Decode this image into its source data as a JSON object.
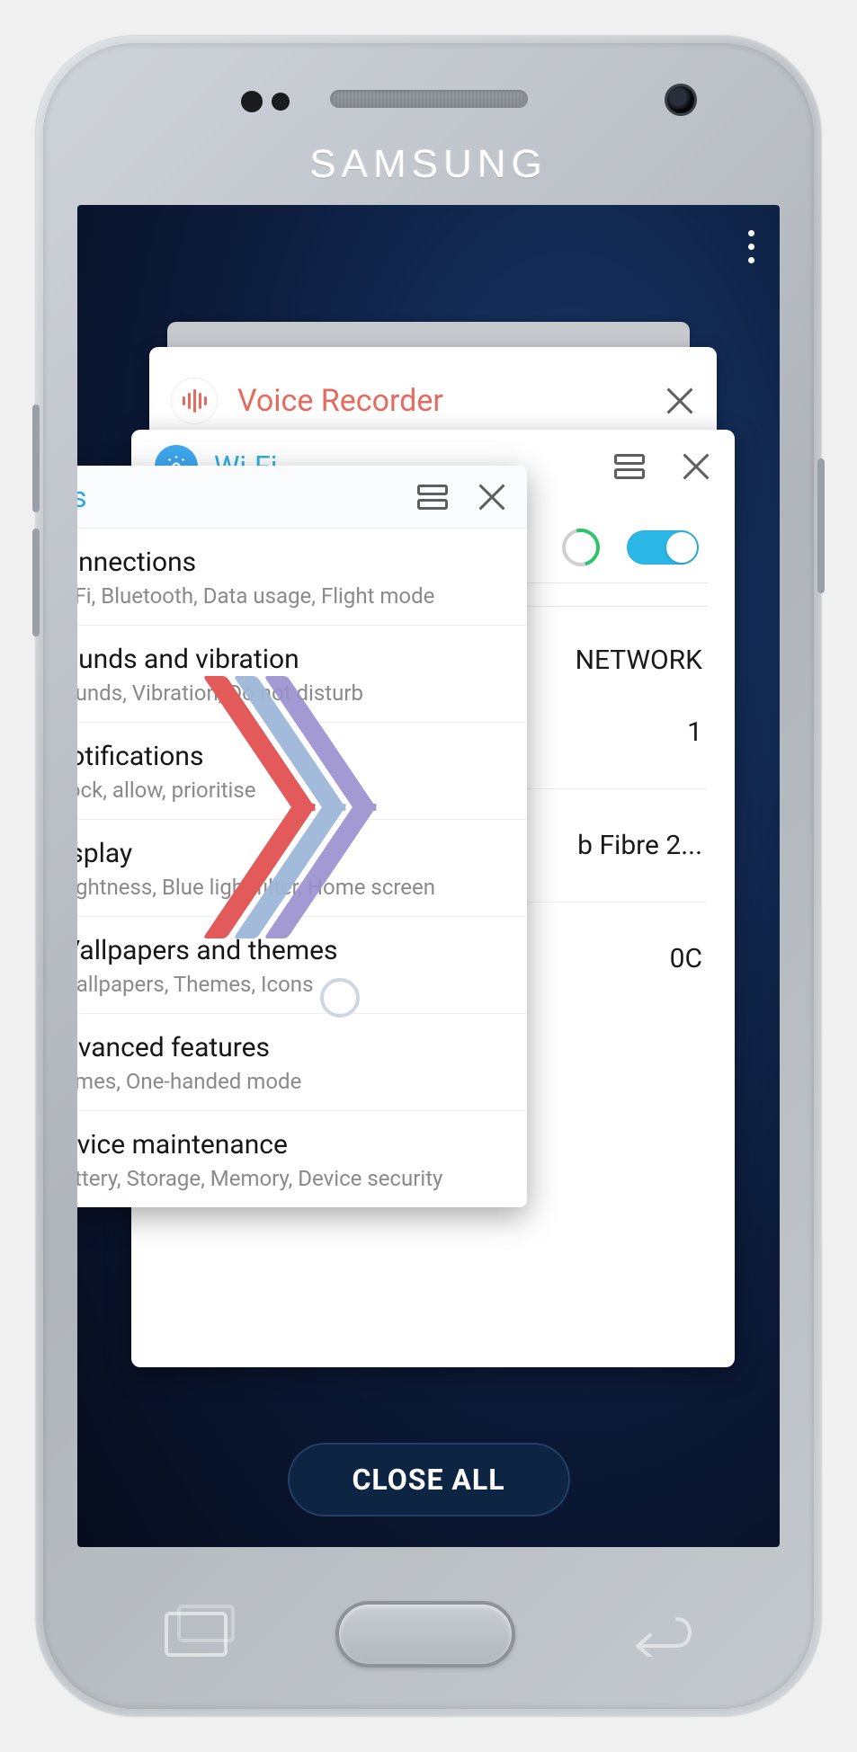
{
  "brand": "SAMSUNG",
  "close_all_label": "CLOSE ALL",
  "cards": {
    "voice_recorder": {
      "title": "Voice Recorder"
    },
    "wifi": {
      "title": "Wi-Fi",
      "toggle_on": true,
      "section_label": "NETWORK",
      "visible_items": [
        "1",
        "b Fibre 2...",
        "0C"
      ]
    },
    "settings": {
      "title_fragment": "gs",
      "items": [
        {
          "title": "onnections",
          "sub": "i-Fi, Bluetooth, Data usage, Flight mode"
        },
        {
          "title": "ounds and vibration",
          "sub": "ounds, Vibration, Do not disturb"
        },
        {
          "title": "lotifications",
          "sub": "lock, allow, prioritise"
        },
        {
          "title": "isplay",
          "sub": "rightness, Blue light filter, Home screen"
        },
        {
          "title": "Vallpapers and themes",
          "sub": "Vallpapers, Themes, Icons"
        },
        {
          "title": "dvanced features",
          "sub": "ames, One-handed mode"
        },
        {
          "title": "evice maintenance",
          "sub": "attery, Storage, Memory, Device security"
        }
      ]
    }
  }
}
